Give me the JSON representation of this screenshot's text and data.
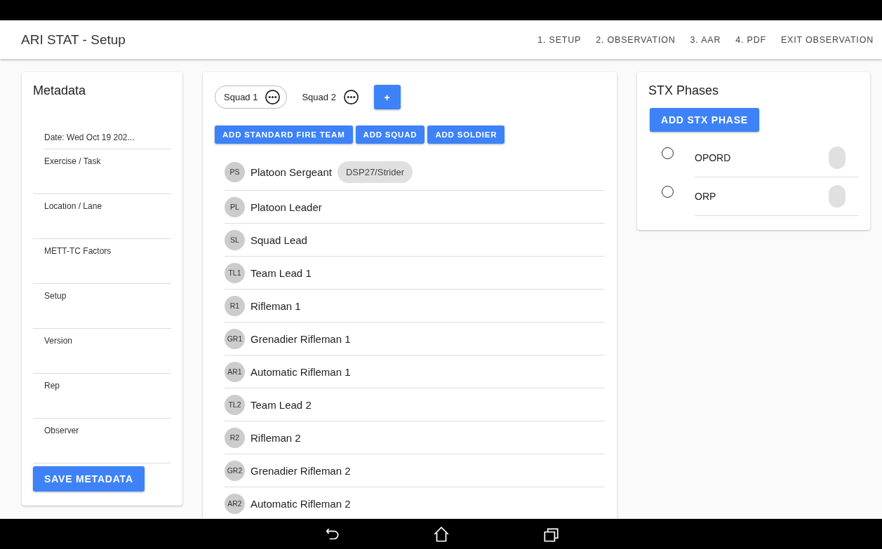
{
  "app_bar": {
    "title": "ARI STAT - Setup",
    "nav": [
      "1. SETUP",
      "2. OBSERVATION",
      "3. AAR",
      "4. PDF",
      "EXIT OBSERVATION"
    ]
  },
  "metadata": {
    "title": "Metadata",
    "fields": [
      {
        "kind": "value",
        "value": "Date: Wed Oct 19 202..."
      },
      {
        "kind": "placeholder",
        "placeholder": "Exercise / Task"
      },
      {
        "kind": "placeholder",
        "placeholder": "Location / Lane"
      },
      {
        "kind": "placeholder",
        "placeholder": "METT-TC Factors"
      },
      {
        "kind": "placeholder",
        "placeholder": "Setup"
      },
      {
        "kind": "placeholder",
        "placeholder": "Version"
      },
      {
        "kind": "placeholder",
        "placeholder": "Rep"
      },
      {
        "kind": "placeholder",
        "placeholder": "Observer"
      }
    ],
    "save_button": "SAVE METADATA"
  },
  "squads": {
    "tabs": [
      {
        "label": "Squad 1",
        "selected": true
      },
      {
        "label": "Squad 2",
        "selected": false
      }
    ],
    "add_button": "+",
    "actions": [
      "ADD STANDARD FIRE TEAM",
      "ADD SQUAD",
      "ADD SOLDIER"
    ],
    "soldiers": [
      {
        "initials": "PS",
        "name": "Platoon Sergeant",
        "tag": "DSP27/Strider"
      },
      {
        "initials": "PL",
        "name": "Platoon Leader"
      },
      {
        "initials": "SL",
        "name": "Squad Lead"
      },
      {
        "initials": "TL1",
        "name": "Team Lead 1"
      },
      {
        "initials": "R1",
        "name": "Rifleman 1"
      },
      {
        "initials": "GR1",
        "name": "Grenadier Rifleman 1"
      },
      {
        "initials": "AR1",
        "name": "Automatic Rifleman 1"
      },
      {
        "initials": "TL2",
        "name": "Team Lead 2"
      },
      {
        "initials": "R2",
        "name": "Rifleman 2"
      },
      {
        "initials": "GR2",
        "name": "Grenadier Rifleman 2"
      },
      {
        "initials": "AR2",
        "name": "Automatic Rifleman 2"
      }
    ]
  },
  "stx": {
    "title": "STX Phases",
    "add_button": "ADD STX PHASE",
    "phases": [
      {
        "name": "OPORD",
        "selected": false,
        "on": false
      },
      {
        "name": "ORP",
        "selected": false,
        "on": false
      }
    ]
  }
}
